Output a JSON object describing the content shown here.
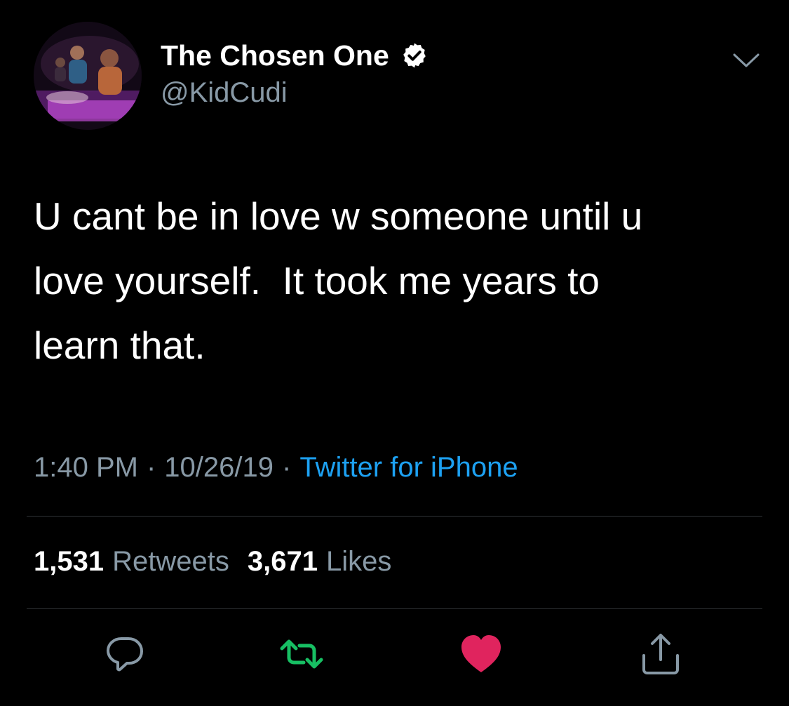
{
  "tweet": {
    "display_name": "The Chosen One",
    "handle": "@KidCudi",
    "verified": true,
    "text": "U cant be in love w someone until u\nlove yourself.  It took me years to\nlearn that.",
    "time": "1:40 PM",
    "separator": "·",
    "date": "10/26/19",
    "source": "Twitter for iPhone",
    "stats": {
      "retweets_count": "1,531",
      "retweets_label": "Retweets",
      "likes_count": "3,671",
      "likes_label": "Likes"
    },
    "liked": true,
    "icons": {
      "verified": "verified-badge-icon",
      "more": "chevron-down-icon",
      "reply": "reply-icon",
      "retweet": "retweet-icon",
      "like": "heart-icon",
      "share": "share-icon"
    },
    "colors": {
      "background": "#000000",
      "text": "#ffffff",
      "secondary": "#8899a6",
      "link": "#1da1f2",
      "retweet_green": "#17bf63",
      "like_red": "#e0245e",
      "divider": "#2f3336"
    }
  }
}
